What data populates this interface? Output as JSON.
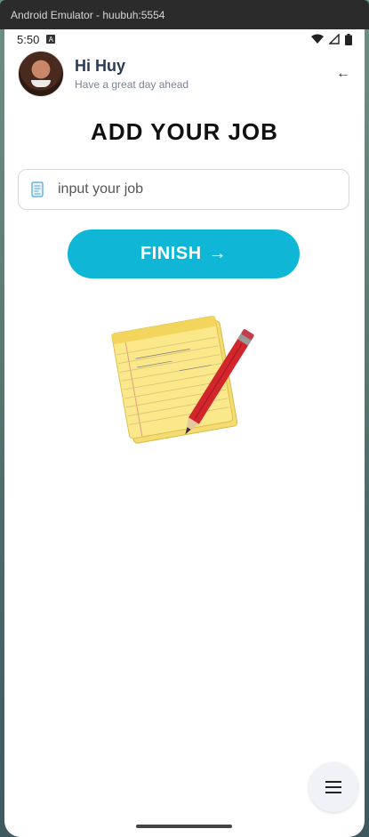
{
  "window": {
    "title": "Android Emulator - huubuh:5554"
  },
  "status_bar": {
    "time": "5:50",
    "notification_icon": "a-icon",
    "icons": [
      "wifi-icon",
      "signal-icon",
      "battery-icon"
    ]
  },
  "header": {
    "greeting": "Hi Huy",
    "subtitle": "Have a great day ahead",
    "back_icon": "←"
  },
  "main": {
    "title": "ADD YOUR JOB",
    "input": {
      "placeholder": "input your job",
      "value": ""
    },
    "finish_label": "FINISH",
    "finish_arrow": "→"
  },
  "colors": {
    "accent": "#0fb6d6",
    "title": "#111111",
    "greeting": "#2b3a55"
  },
  "fab": {
    "icon": "menu-icon"
  }
}
